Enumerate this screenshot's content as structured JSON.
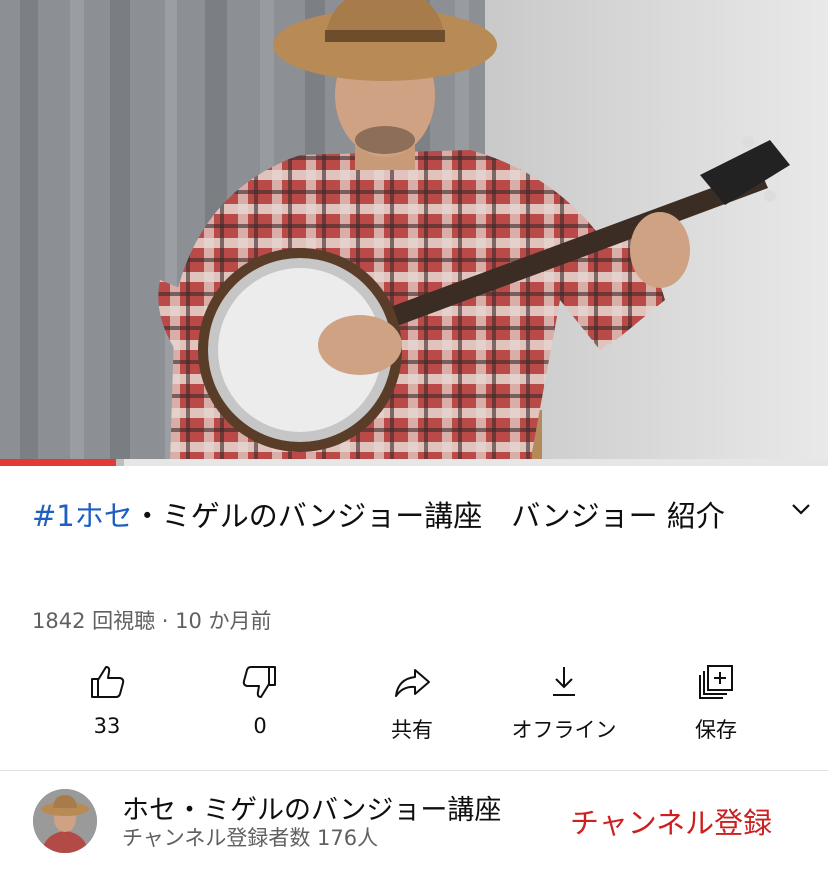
{
  "video": {
    "title_hashtag": "#1ホセ",
    "title_rest": "・ミゲルのバンジョー講座　バンジョー 紹介",
    "meta": "1842 回視聴 · 10 か月前",
    "progress_played": 0.14,
    "progress_buffered": 0.15
  },
  "actions": [
    {
      "icon": "thumbs-up-icon",
      "label": "33"
    },
    {
      "icon": "thumbs-down-icon",
      "label": "0"
    },
    {
      "icon": "share-icon",
      "label": "共有"
    },
    {
      "icon": "download-icon",
      "label": "オフライン"
    },
    {
      "icon": "save-icon",
      "label": "保存"
    }
  ],
  "channel": {
    "name": "ホセ・ミゲルのバンジョー講座",
    "subscribers": "チャンネル登録者数 176人",
    "subscribe_label": "チャンネル登録"
  },
  "colors": {
    "hashtag": "#1f5fbf",
    "subscribe": "#cc1f1f",
    "progress_played": "#e53935"
  }
}
